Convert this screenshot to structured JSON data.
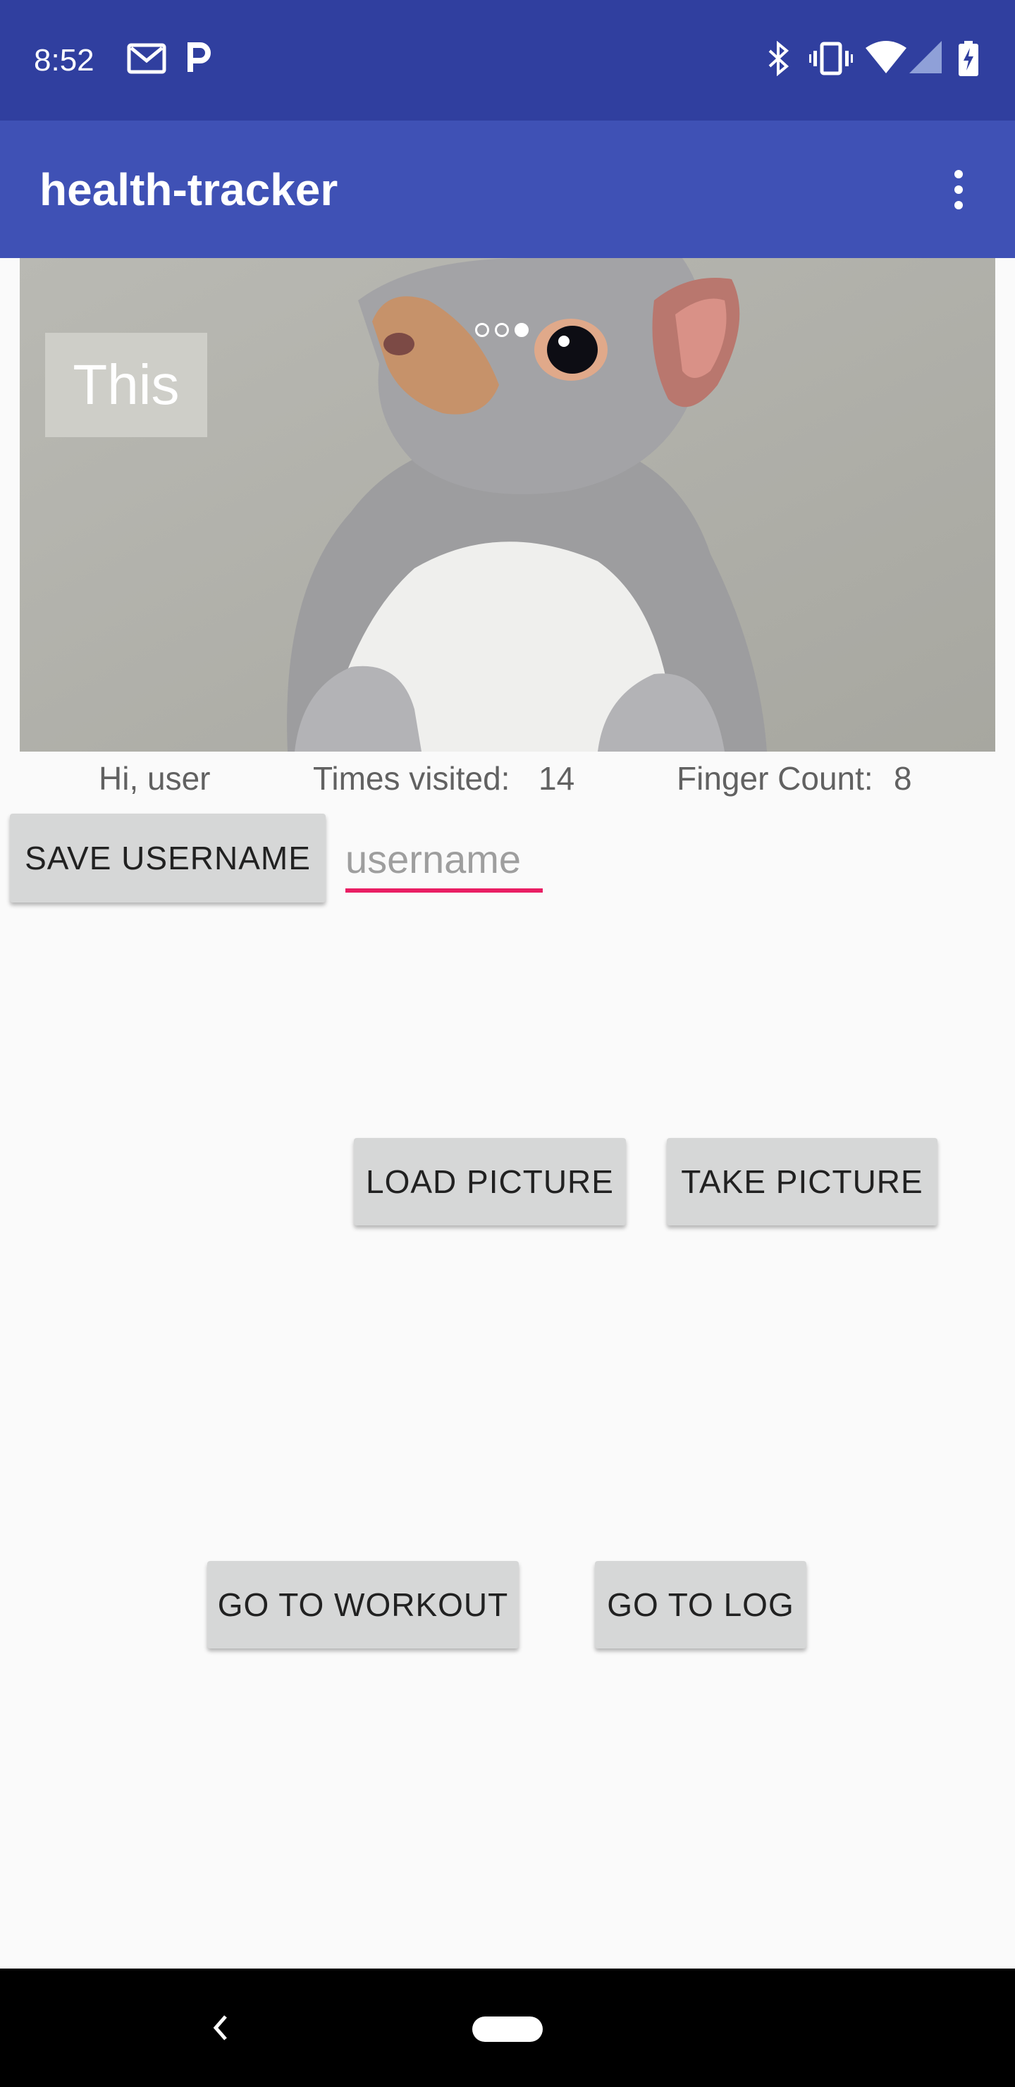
{
  "status_bar": {
    "time": "8:52",
    "left_icons": [
      "gmail-icon",
      "parking-icon"
    ],
    "right_icons": [
      "bluetooth-icon",
      "vibrate-icon",
      "wifi-icon",
      "signal-icon",
      "battery-charging-icon"
    ]
  },
  "app_bar": {
    "title": "health-tracker",
    "menu_icon": "overflow-menu-icon"
  },
  "carousel": {
    "caption": "This",
    "page_count": 3,
    "active_index": 2
  },
  "info": {
    "greeting": "Hi, user",
    "times_visited_label": "Times visited:",
    "times_visited_value": "14",
    "finger_count_label": "Finger Count:",
    "finger_count_value": "8"
  },
  "buttons": {
    "save_username": "SAVE USERNAME",
    "load_picture": "LOAD PICTURE",
    "take_picture": "TAKE PICTURE",
    "go_to_workout": "GO TO WORKOUT",
    "go_to_log": "GO TO LOG"
  },
  "username_input": {
    "placeholder": "username",
    "value": ""
  },
  "colors": {
    "status_bar": "#303f9f",
    "app_bar": "#3f51b5",
    "input_accent": "#e91e63",
    "button_bg": "#d6d7d7"
  }
}
